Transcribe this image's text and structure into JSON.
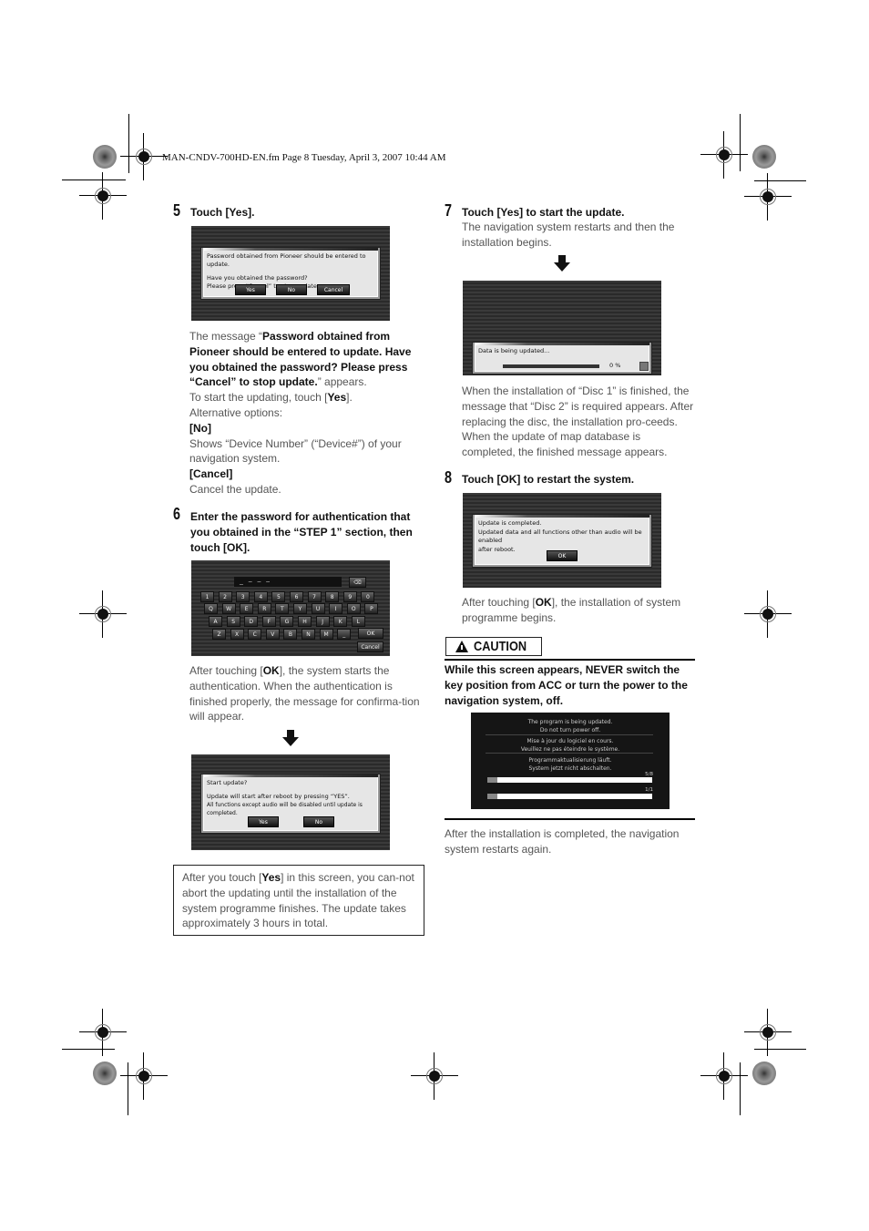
{
  "header": {
    "file_info": "MAN-CNDV-700HD-EN.fm  Page 8  Tuesday, April 3, 2007  10:44 AM"
  },
  "step5": {
    "number": "5",
    "title": "Touch [Yes].",
    "screen": {
      "line1": "Password obtained from Pioneer should be entered to update.",
      "line2": "Have you obtained the password?",
      "line3": "Please press “Cancel” to stop update.",
      "buttons": [
        "Yes",
        "No",
        "Cancel"
      ]
    },
    "para_prefix": "The message “",
    "para_bold": "Password obtained from Pioneer should be entered to update. Have you obtained the password? Please press “Cancel” to stop update.",
    "para_suffix": "” appears.",
    "start_prefix": "To start the updating, touch [",
    "start_bold": "Yes",
    "start_suffix": "].",
    "alt_label": "Alternative options:",
    "opt_no": "[No]",
    "opt_no_desc": "Shows “Device Number” (“Device#”) of your navigation system.",
    "opt_cancel": "[Cancel]",
    "opt_cancel_desc": "Cancel the update."
  },
  "step6": {
    "number": "6",
    "title": "Enter the password for authentication that you obtained in the “STEP 1” section, then touch [OK].",
    "keyboard": {
      "row1": [
        "1",
        "2",
        "3",
        "4",
        "5",
        "6",
        "7",
        "8",
        "9",
        "0"
      ],
      "row2": [
        "Q",
        "W",
        "E",
        "R",
        "T",
        "Y",
        "U",
        "I",
        "O",
        "P"
      ],
      "row3": [
        "A",
        "S",
        "D",
        "F",
        "G",
        "H",
        "J",
        "K",
        "L"
      ],
      "row4": [
        "Z",
        "X",
        "C",
        "V",
        "B",
        "N",
        "M",
        "_"
      ],
      "ok": "OK",
      "cancel": "Cancel",
      "backspace": "⌫",
      "password_field": "_   –   –   –"
    },
    "para_prefix": "After touching [",
    "para_bold": "OK",
    "para_suffix": "], the system starts the authentication. When the authentication is finished properly, the message for confirma-tion will appear.",
    "confirm_screen": {
      "line1": "Start update?",
      "line2": "Update will start after reboot by pressing “YES”.",
      "line3": "All functions except audio will be disabled until update is completed.",
      "buttons": [
        "Yes",
        "No"
      ]
    },
    "note_prefix": "After you touch [",
    "note_bold": "Yes",
    "note_suffix": "] in this screen, you can-not abort the updating until the installation of the system programme finishes. The update takes approximately 3 hours in total."
  },
  "step7": {
    "number": "7",
    "title": "Touch [Yes] to start the update.",
    "desc": "The navigation system restarts and then the installation begins.",
    "progress_screen": {
      "message": "Data is being updated...",
      "percent_label": "0 %",
      "progress_percent": 0
    },
    "after": "When the installation of “Disc 1” is finished, the message that “Disc 2” is required appears. After replacing the disc, the installation pro-ceeds. When the update of map database is completed, the finished message appears."
  },
  "step8": {
    "number": "8",
    "title": "Touch [OK] to restart the system.",
    "screen": {
      "line1": "Update is completed.",
      "line2": "Updated data and all functions other than audio will be enabled",
      "line3": "after reboot.",
      "button": "OK"
    },
    "para_prefix": "After touching [",
    "para_bold": "OK",
    "para_suffix": "], the installation of system programme begins."
  },
  "caution": {
    "label": "CAUTION",
    "text_a": "While this screen appears, ",
    "text_b": "NEVER",
    "text_c": " switch the key position from ",
    "text_d": "ACC",
    "text_e": " or turn the power to the navigation system, off.",
    "screen": {
      "en1": "The program is being updated.",
      "en2": "Do not turn power off.",
      "fr1": "Mise à jour du logiciel en cours.",
      "fr2": "Veuillez ne pas éteindre le système.",
      "de1": "Programmaktualisierung läuft.",
      "de2": "System jetzt nicht abschalten.",
      "bar1_label": "5/8",
      "bar1_fraction": 0.06,
      "bar2_label": "1/1",
      "bar2_fraction": 0.06
    },
    "after": "After the installation is completed, the navigation system restarts again."
  }
}
